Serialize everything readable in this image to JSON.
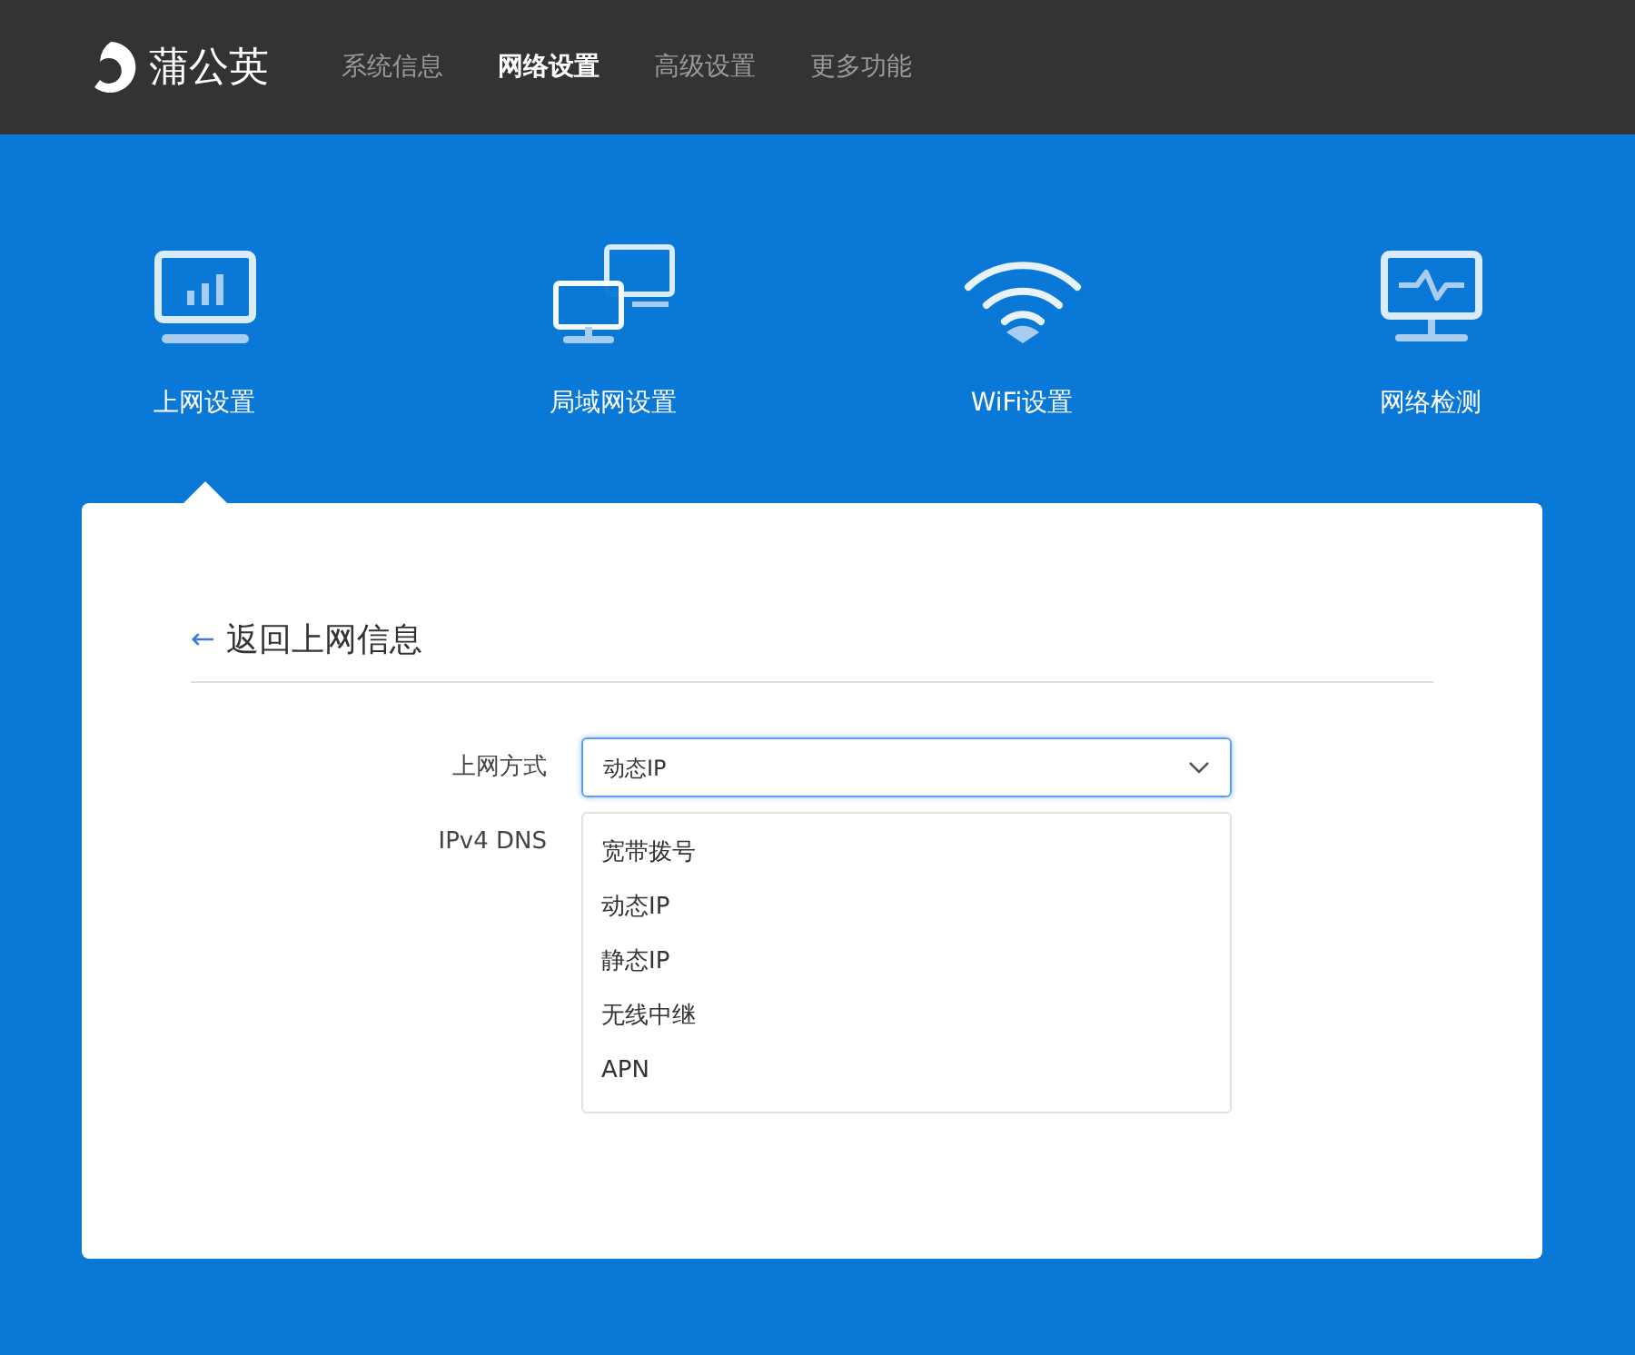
{
  "brand": {
    "name": "蒲公英"
  },
  "nav": [
    {
      "label": "系统信息",
      "selected": false
    },
    {
      "label": "网络设置",
      "selected": true
    },
    {
      "label": "高级设置",
      "selected": false
    },
    {
      "label": "更多功能",
      "selected": false
    }
  ],
  "sections": [
    {
      "kind": "monitor",
      "label": "上网设置",
      "selected": true
    },
    {
      "kind": "lan",
      "label": "局域网设置",
      "selected": false
    },
    {
      "kind": "wifi",
      "label": "WiFi设置",
      "selected": false
    },
    {
      "kind": "diagnose",
      "label": "网络检测",
      "selected": false
    }
  ],
  "back_link": {
    "arrow": "←",
    "label": "返回上网信息"
  },
  "form": {
    "fields": [
      {
        "label": "上网方式",
        "value": "动态IP",
        "expanded": true
      },
      {
        "label": "IPv4 DNS"
      }
    ],
    "dropdown_options": [
      "宽带拨号",
      "动态IP",
      "静态IP",
      "无线中继",
      "APN"
    ]
  }
}
